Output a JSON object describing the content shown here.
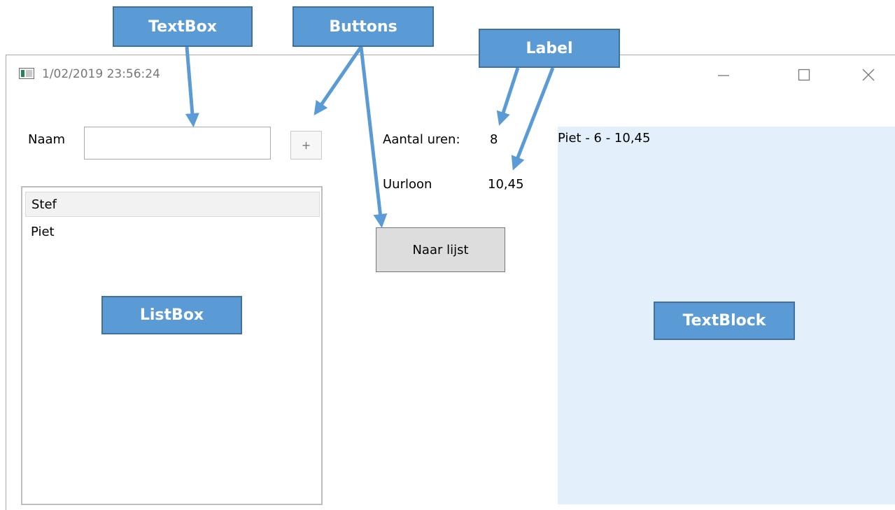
{
  "window": {
    "title": "1/02/2019 23:56:24",
    "controls": {
      "minimize": "—",
      "maximize": "☐",
      "close": "✕"
    }
  },
  "form": {
    "naam_label": "Naam",
    "naam_value": "",
    "add_button": "+",
    "listbox_items": [
      "Stef",
      "Piet"
    ],
    "aantal_uren_label": "Aantal uren:",
    "aantal_uren_value": "8",
    "uurloon_label": "Uurloon",
    "uurloon_value": "10,45",
    "naar_lijst_button": "Naar lijst",
    "textblock_text": "Piet - 6 - 10,45"
  },
  "callouts": {
    "textbox": "TextBox",
    "buttons": "Buttons",
    "label": "Label",
    "listbox": "ListBox",
    "textblock": "TextBlock"
  },
  "colors": {
    "callout_fill": "#5b9bd5",
    "callout_border": "#41719c",
    "textblock_bg": "#e3effb"
  }
}
